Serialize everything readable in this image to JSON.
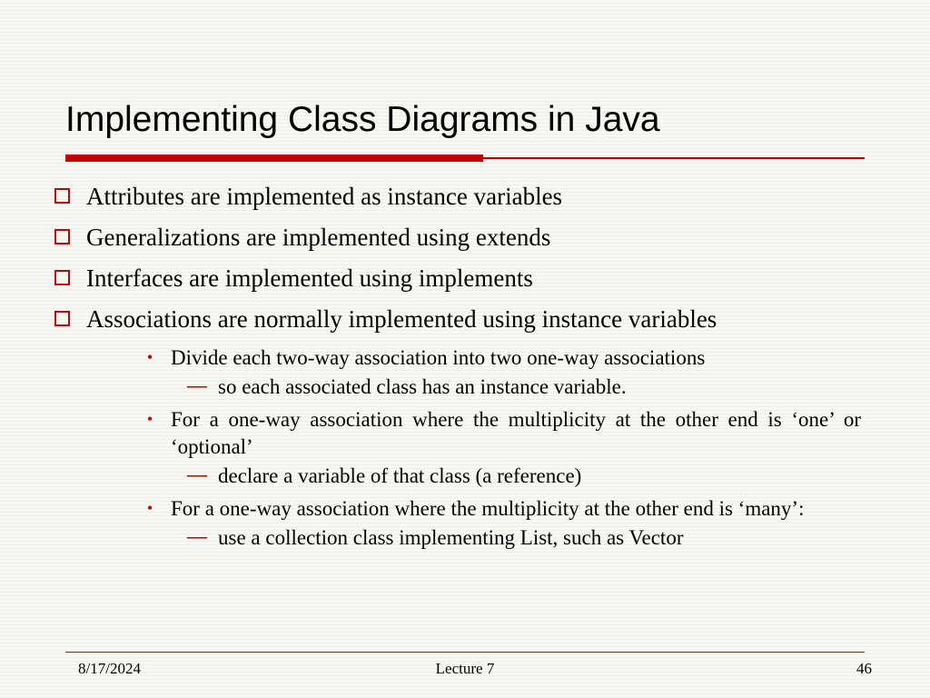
{
  "title": "Implementing Class Diagrams in Java",
  "bullets": {
    "b1": "Attributes are implemented as instance variables",
    "b2": "Generalizations are implemented using extends",
    "b3": "Interfaces are implemented using implements",
    "b4": "Associations are normally implemented using instance variables",
    "s1": "Divide each two-way association into two one-way associations",
    "s1a": "so each associated class has an instance variable.",
    "s2": "For a one-way association where the multiplicity at the other end is ‘one’ or ‘optional’",
    "s2a": "declare a variable of that class (a reference)",
    "s3": "For a one-way association where the multiplicity at the other end is ‘many’:",
    "s3a": "use a collection class implementing List, such as Vector"
  },
  "footer": {
    "date": "8/17/2024",
    "center": "Lecture 7",
    "page": "46"
  }
}
